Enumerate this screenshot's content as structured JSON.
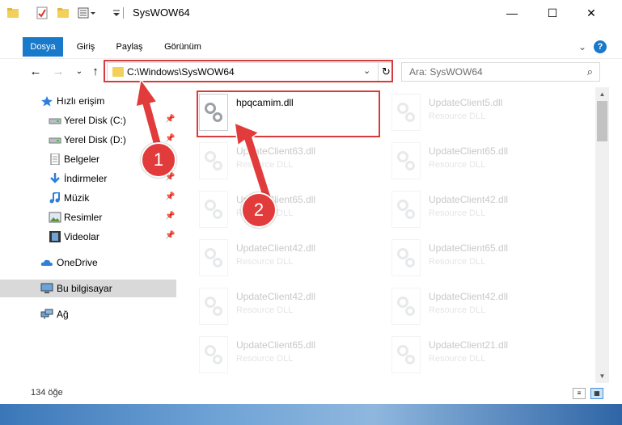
{
  "window": {
    "title": "SysWOW64",
    "controls": {
      "minimize": "—",
      "maximize": "☐",
      "close": "✕"
    }
  },
  "ribbon": {
    "tabs": [
      {
        "label": "Dosya",
        "active": true
      },
      {
        "label": "Giriş",
        "active": false
      },
      {
        "label": "Paylaş",
        "active": false
      },
      {
        "label": "Görünüm",
        "active": false
      }
    ],
    "help": "?",
    "expand": "⌄"
  },
  "nav": {
    "back": "←",
    "forward": "→",
    "recent": "⌄",
    "up": "↑",
    "address": "C:\\Windows\\SysWOW64",
    "address_dropdown": "⌄",
    "refresh": "↻",
    "search_placeholder": "Ara: SysWOW64",
    "search_icon": "⌕"
  },
  "sidebar": {
    "quick_access": "Hızlı erişim",
    "items": [
      {
        "label": "Yerel Disk (C:)",
        "icon": "drive-icon"
      },
      {
        "label": "Yerel Disk (D:)",
        "icon": "drive-icon"
      },
      {
        "label": "Belgeler",
        "icon": "documents-icon"
      },
      {
        "label": "İndirmeler",
        "icon": "downloads-icon"
      },
      {
        "label": "Müzik",
        "icon": "music-icon"
      },
      {
        "label": "Resimler",
        "icon": "pictures-icon"
      },
      {
        "label": "Videolar",
        "icon": "videos-icon"
      }
    ],
    "onedrive": "OneDrive",
    "this_pc": "Bu bilgisayar",
    "network": "Ağ"
  },
  "files": [
    {
      "name": "hpqcamim.dll",
      "type": "",
      "highlighted": true
    },
    {
      "name": "UpdateClient5.dll",
      "type": "Resource DLL"
    },
    {
      "name": "UpdateClient63.dll",
      "type": "Resource DLL"
    },
    {
      "name": "UpdateClient65.dll",
      "type": "Resource DLL"
    },
    {
      "name": "UpdateClient65.dll",
      "type": "Resource DLL"
    },
    {
      "name": "UpdateClient42.dll",
      "type": "Resource DLL"
    },
    {
      "name": "UpdateClient42.dll",
      "type": "Resource DLL"
    },
    {
      "name": "UpdateClient65.dll",
      "type": "Resource DLL"
    },
    {
      "name": "UpdateClient42.dll",
      "type": "Resource DLL"
    },
    {
      "name": "UpdateClient42.dll",
      "type": "Resource DLL"
    },
    {
      "name": "UpdateClient65.dll",
      "type": "Resource DLL"
    },
    {
      "name": "UpdateClient21.dll",
      "type": "Resource DLL"
    }
  ],
  "status": {
    "count": "134 öğe"
  },
  "callouts": {
    "one": "1",
    "two": "2"
  },
  "colors": {
    "accent": "#1979ca",
    "highlight": "#d93a3a",
    "callout": "#e23b3b"
  }
}
